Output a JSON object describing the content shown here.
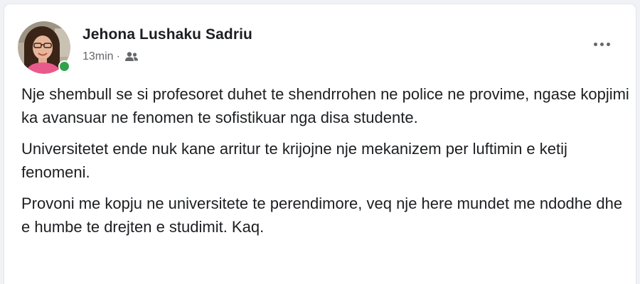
{
  "post": {
    "author": {
      "name": "Jehona Lushaku Sadriu",
      "online": true,
      "online_color": "#31a24c",
      "avatar_icon": "profile-photo"
    },
    "timestamp": "13min",
    "separator": "·",
    "audience_icon": "friends-icon",
    "more_icon": "more-options-icon",
    "paragraphs": [
      "Nje shembull se si profesoret duhet te shendrrohen ne police ne provime, ngase kopjimi ka avansuar ne fenomen te sofistikuar nga disa studente.",
      "Universitetet ende nuk kane arritur te krijojne nje mekanizem per luftimin e ketij fenomeni.",
      "Provoni me kopju ne universitete te perendimore, veq nje here mundet me ndodhe dhe e humbe te drejten e studimit. Kaq."
    ]
  },
  "colors": {
    "background": "#f0f2f5",
    "card": "#ffffff",
    "text": "#1c1e21",
    "secondary_text": "#65676b"
  }
}
